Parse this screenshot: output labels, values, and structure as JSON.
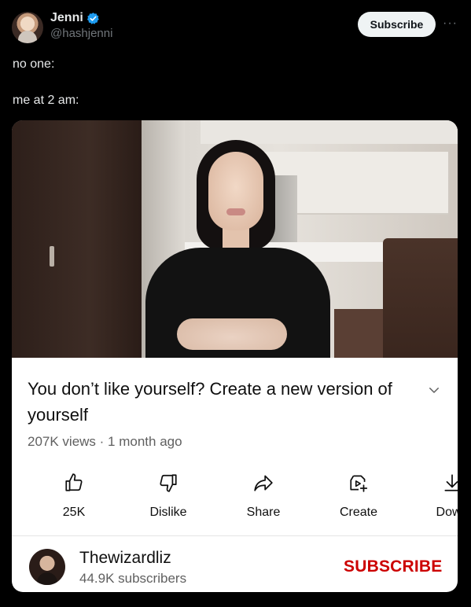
{
  "post": {
    "author_name": "Jenni",
    "author_handle": "@hashjenni",
    "subscribe_label": "Subscribe",
    "more_label": "···",
    "lines": [
      "no one:",
      "me at 2 am:"
    ]
  },
  "video": {
    "title": "You don’t like yourself? Create a new version of yourself",
    "meta": "207K views · 1 month ago",
    "actions": [
      {
        "icon": "thumbs-up-icon",
        "label": "25K"
      },
      {
        "icon": "thumbs-down-icon",
        "label": "Dislike"
      },
      {
        "icon": "share-icon",
        "label": "Share"
      },
      {
        "icon": "create-icon",
        "label": "Create"
      },
      {
        "icon": "download-icon",
        "label": "Down"
      }
    ],
    "channel": {
      "name": "Thewizardliz",
      "subscribers": "44.9K subscribers",
      "subscribe_label": "SUBSCRIBE"
    }
  },
  "colors": {
    "verified": "#1d9bf0",
    "subscribe_red": "#cc0000",
    "background": "#000000"
  }
}
